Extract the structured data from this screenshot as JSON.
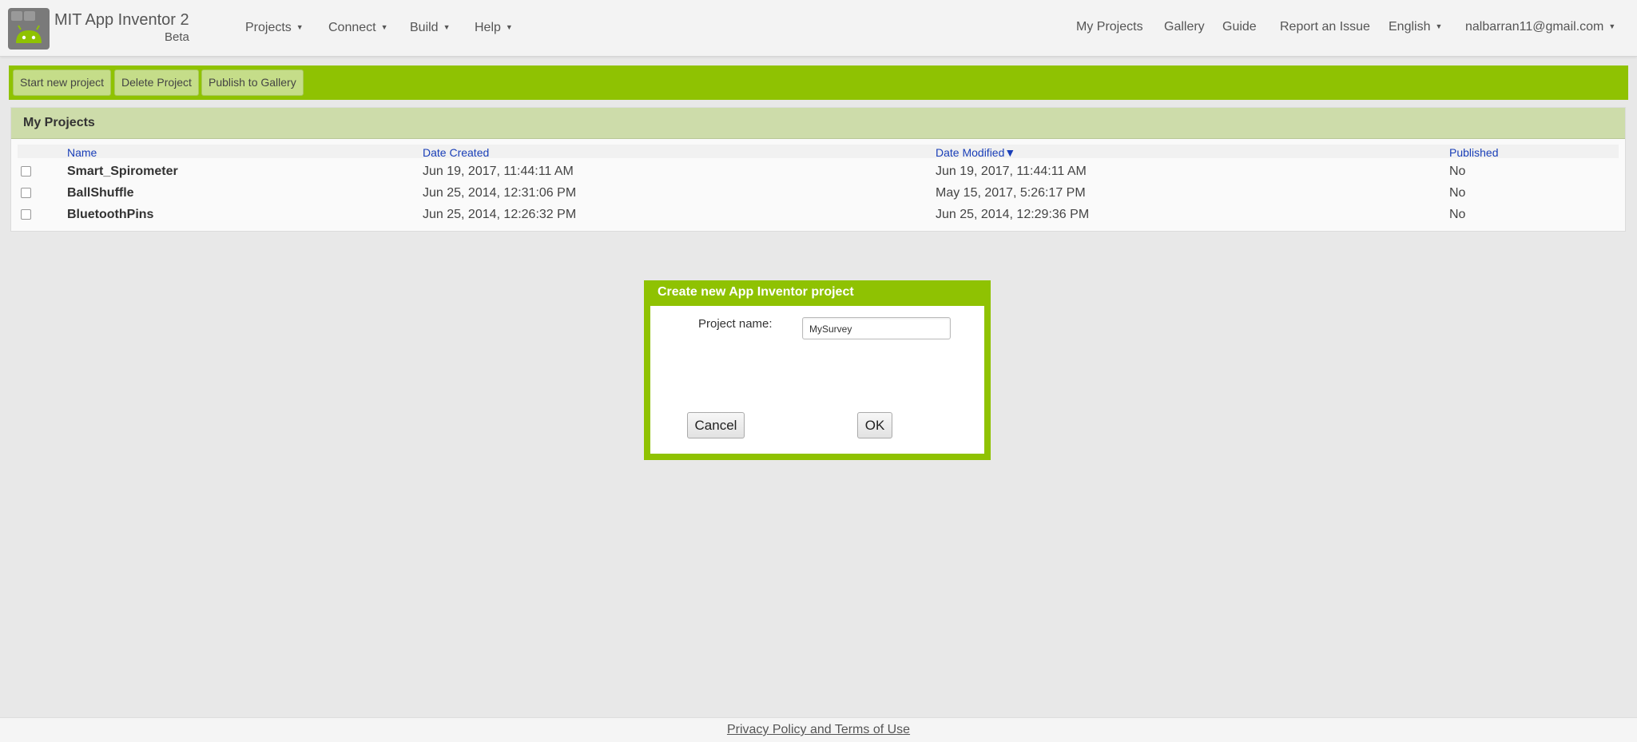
{
  "app": {
    "title": "MIT App Inventor 2",
    "subtitle": "Beta",
    "logo_icon": "android-robot-logo"
  },
  "menus": [
    {
      "label": "Projects"
    },
    {
      "label": "Connect"
    },
    {
      "label": "Build"
    },
    {
      "label": "Help"
    }
  ],
  "right_nav": {
    "my_projects": "My Projects",
    "gallery": "Gallery",
    "guide": "Guide",
    "report": "Report an Issue",
    "language": "English",
    "account": "nalbarran11@gmail.com"
  },
  "toolbar": {
    "start_new": "Start new project",
    "delete": "Delete Project",
    "publish": "Publish to Gallery"
  },
  "projects_panel": {
    "title": "My Projects",
    "columns": {
      "name": "Name",
      "created": "Date Created",
      "modified": "Date Modified",
      "sort_indicator": "▼",
      "published": "Published"
    },
    "rows": [
      {
        "name": "Smart_Spirometer",
        "created": "Jun 19, 2017, 11:44:11 AM",
        "modified": "Jun 19, 2017, 11:44:11 AM",
        "published": "No"
      },
      {
        "name": "BallShuffle",
        "created": "Jun 25, 2014, 12:31:06 PM",
        "modified": "May 15, 2017, 5:26:17 PM",
        "published": "No"
      },
      {
        "name": "BluetoothPins",
        "created": "Jun 25, 2014, 12:26:32 PM",
        "modified": "Jun 25, 2014, 12:29:36 PM",
        "published": "No"
      }
    ]
  },
  "dialog": {
    "title": "Create new App Inventor project",
    "field_label": "Project name:",
    "field_value": "MySurvey",
    "cancel": "Cancel",
    "ok": "OK"
  },
  "footer": {
    "link": "Privacy Policy and Terms of Use"
  },
  "colors": {
    "accent_green": "#8fc202",
    "panel_header": "#cddcaa",
    "link_blue": "#1a3fb8"
  }
}
